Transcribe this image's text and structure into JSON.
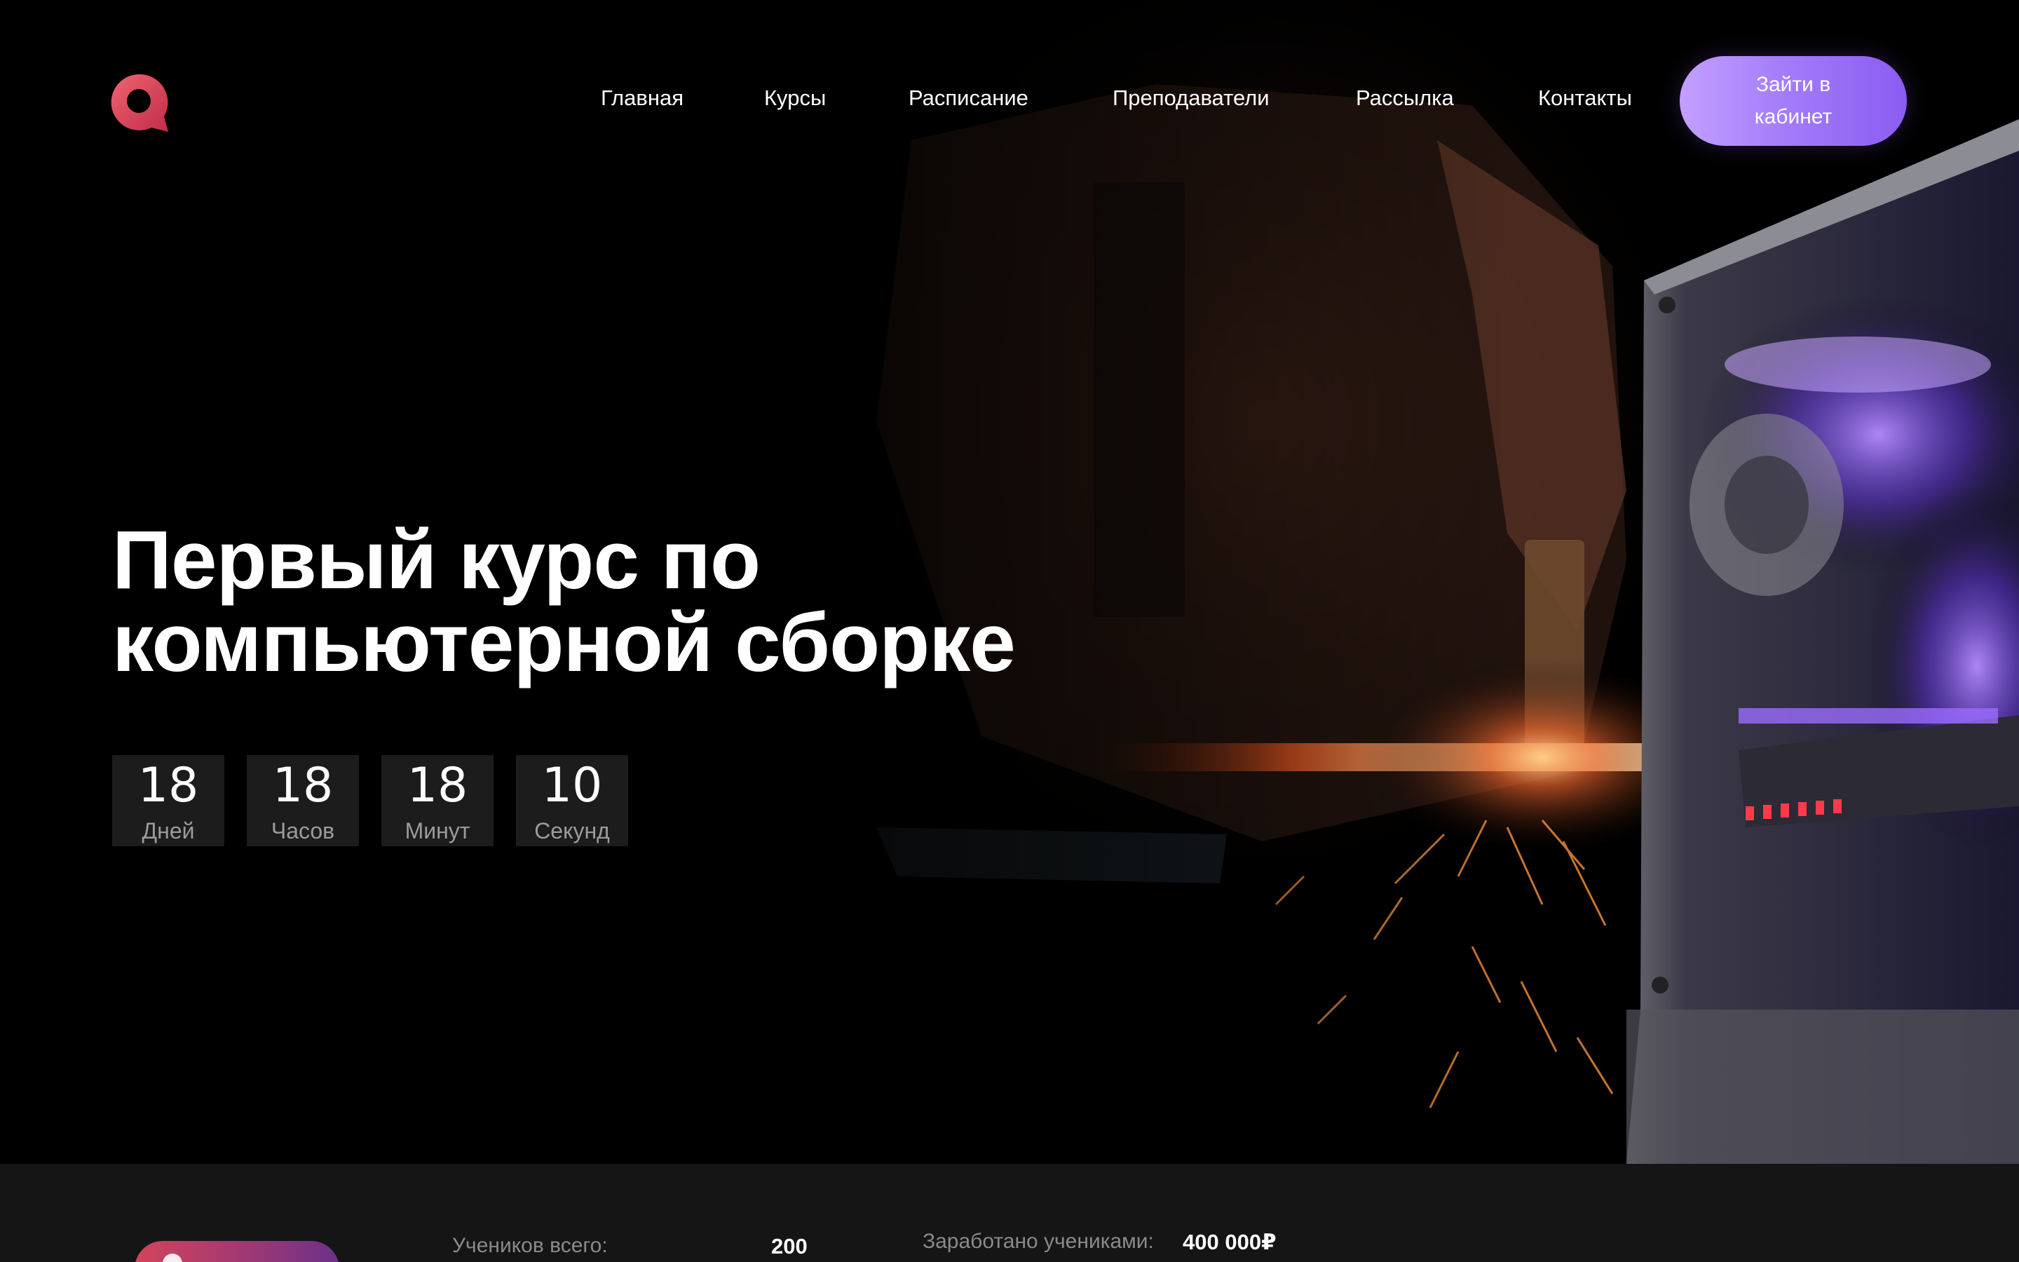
{
  "header": {
    "logo_icon": "q-speech-bubble-logo-icon",
    "nav": [
      {
        "label": "Главная"
      },
      {
        "label": "Курсы"
      },
      {
        "label": "Расписание"
      },
      {
        "label": "Преподаватели"
      },
      {
        "label": "Рассылка"
      },
      {
        "label": "Контакты"
      }
    ],
    "login_label": "Зайти в кабинет"
  },
  "hero": {
    "title_line1": "Первый курс по",
    "title_line2": "компьютерной сборке",
    "countdown": [
      {
        "value": "18",
        "label": "Дней"
      },
      {
        "value": "18",
        "label": "Часов"
      },
      {
        "value": "18",
        "label": "Минут"
      },
      {
        "value": "10",
        "label": "Секунд"
      }
    ]
  },
  "stats": {
    "students_label": "Учеников всего:",
    "students_value": "200",
    "earned_label": "Заработано учениками:",
    "earned_value": "400 000₽"
  },
  "colors": {
    "accent_purple": "#a47dfa",
    "accent_red": "#d2445c",
    "strip_bg": "#151515"
  }
}
